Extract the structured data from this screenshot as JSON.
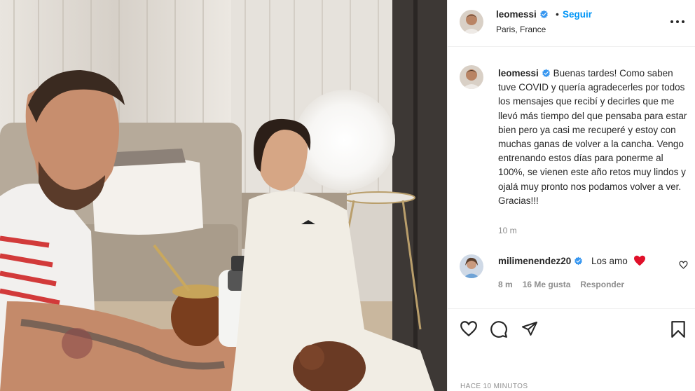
{
  "post": {
    "username": "leomessi",
    "verified": true,
    "follow_label": "Seguir",
    "separator": "•",
    "location": "Paris, France",
    "caption": "Buenas tardes! Como saben tuve COVID y quería agradecerles por todos los mensajes que recibí y decirles que me llevó más tiempo del que pensaba para estar bien pero ya casi me recuperé y estoy con muchas ganas de volver a la cancha. Vengo entrenando estos días para ponerme al 100%, se vienen este año retos muy lindos y ojalá muy pronto nos podamos volver a ver. Gracias!!!",
    "caption_time": "10 m",
    "posted_ago": "HACE 10 MINUTOS"
  },
  "comment": {
    "username": "milimenendez20",
    "verified": true,
    "text": "Los amo",
    "time": "8 m",
    "likes": "16 Me gusta",
    "reply_label": "Responder"
  },
  "colors": {
    "link_blue": "#0095f6",
    "verified_blue": "#3897f0",
    "heart_red": "#ed4956",
    "muted": "#8e8e8e",
    "text": "#262626"
  },
  "icons": [
    "more-options-icon",
    "verified-badge-icon",
    "heart-icon",
    "comment-icon",
    "share-icon",
    "save-icon",
    "red-heart-emoji"
  ]
}
